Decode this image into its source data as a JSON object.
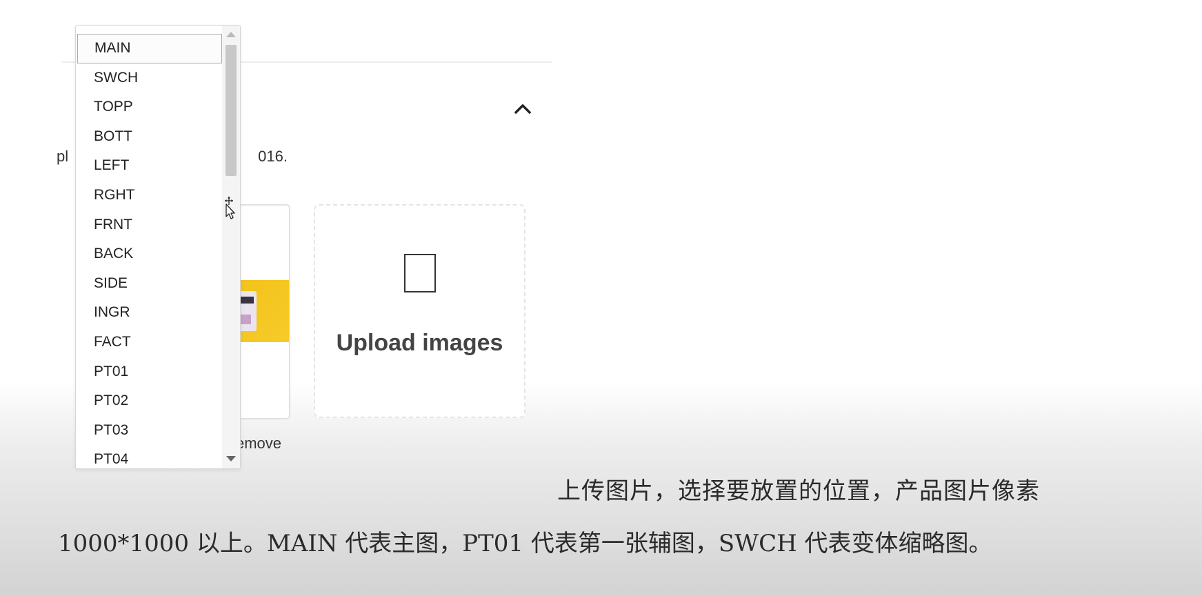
{
  "page": {
    "hint_prefix": "pl",
    "hint_suffix": "016.",
    "remove_label": "emove"
  },
  "upload": {
    "label": "Upload images"
  },
  "dropdown": {
    "options": [
      "MAIN",
      "SWCH",
      "TOPP",
      "BOTT",
      "LEFT",
      "RGHT",
      "FRNT",
      "BACK",
      "SIDE",
      "INGR",
      "FACT",
      "PT01",
      "PT02",
      "PT03",
      "PT04"
    ],
    "selected": "MAIN"
  },
  "caption": {
    "line1": "上传图片，选择要放置的位置，产品图片像素",
    "line2": "1000*1000 以上。MAIN 代表主图，PT01 代表第一张辅图，SWCH 代表变体缩略图。"
  },
  "icons": {
    "collapse": "chevron-up-icon",
    "upload": "image-placeholder-icon",
    "cursor": "move-cursor-icon"
  }
}
